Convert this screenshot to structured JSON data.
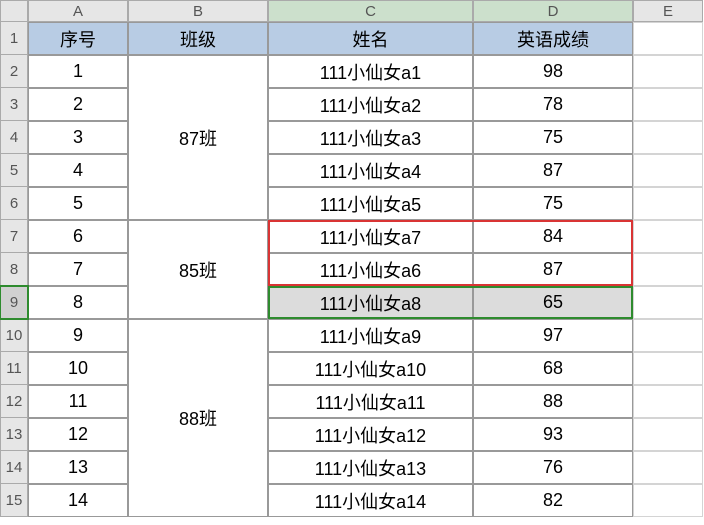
{
  "columns": [
    "A",
    "B",
    "C",
    "D",
    "E"
  ],
  "rows": [
    "1",
    "2",
    "3",
    "4",
    "5",
    "6",
    "7",
    "8",
    "9",
    "10",
    "11",
    "12",
    "13",
    "14",
    "15"
  ],
  "headers": {
    "a": "序号",
    "b": "班级",
    "c": "姓名",
    "d": "英语成绩"
  },
  "data": [
    {
      "num": "1",
      "name": "111小仙女a1",
      "score": "98"
    },
    {
      "num": "2",
      "name": "111小仙女a2",
      "score": "78"
    },
    {
      "num": "3",
      "name": "111小仙女a3",
      "score": "75"
    },
    {
      "num": "4",
      "name": "111小仙女a4",
      "score": "87"
    },
    {
      "num": "5",
      "name": "111小仙女a5",
      "score": "75"
    },
    {
      "num": "6",
      "name": "111小仙女a7",
      "score": "84"
    },
    {
      "num": "7",
      "name": "111小仙女a6",
      "score": "87"
    },
    {
      "num": "8",
      "name": "111小仙女a8",
      "score": "65"
    },
    {
      "num": "9",
      "name": "111小仙女a9",
      "score": "97"
    },
    {
      "num": "10",
      "name": "111小仙女a10",
      "score": "68"
    },
    {
      "num": "11",
      "name": "111小仙女a11",
      "score": "88"
    },
    {
      "num": "12",
      "name": "111小仙女a12",
      "score": "93"
    },
    {
      "num": "13",
      "name": "111小仙女a13",
      "score": "76"
    },
    {
      "num": "14",
      "name": "111小仙女a14",
      "score": "82"
    }
  ],
  "class_groups": [
    {
      "label": "87班",
      "span": 5
    },
    {
      "label": "85班",
      "span": 3
    },
    {
      "label": "88班",
      "span": 6
    }
  ],
  "chart_data": {
    "type": "table",
    "title": "",
    "columns": [
      "序号",
      "班级",
      "姓名",
      "英语成绩"
    ],
    "rows": [
      [
        "1",
        "87班",
        "111小仙女a1",
        "98"
      ],
      [
        "2",
        "87班",
        "111小仙女a2",
        "78"
      ],
      [
        "3",
        "87班",
        "111小仙女a3",
        "75"
      ],
      [
        "4",
        "87班",
        "111小仙女a4",
        "87"
      ],
      [
        "5",
        "87班",
        "111小仙女a5",
        "75"
      ],
      [
        "6",
        "85班",
        "111小仙女a7",
        "84"
      ],
      [
        "7",
        "85班",
        "111小仙女a6",
        "87"
      ],
      [
        "8",
        "85班",
        "111小仙女a8",
        "65"
      ],
      [
        "9",
        "88班",
        "111小仙女a9",
        "97"
      ],
      [
        "10",
        "88班",
        "111小仙女a10",
        "68"
      ],
      [
        "11",
        "88班",
        "111小仙女a11",
        "88"
      ],
      [
        "12",
        "88班",
        "111小仙女a12",
        "93"
      ],
      [
        "13",
        "88班",
        "111小仙女a13",
        "76"
      ],
      [
        "14",
        "88班",
        "111小仙女a14",
        "82"
      ]
    ]
  },
  "selection": {
    "row_index": 8,
    "cols": [
      "C",
      "D"
    ]
  },
  "highlight_red": {
    "rows": [
      7,
      8
    ],
    "cols": [
      "C",
      "D"
    ]
  }
}
